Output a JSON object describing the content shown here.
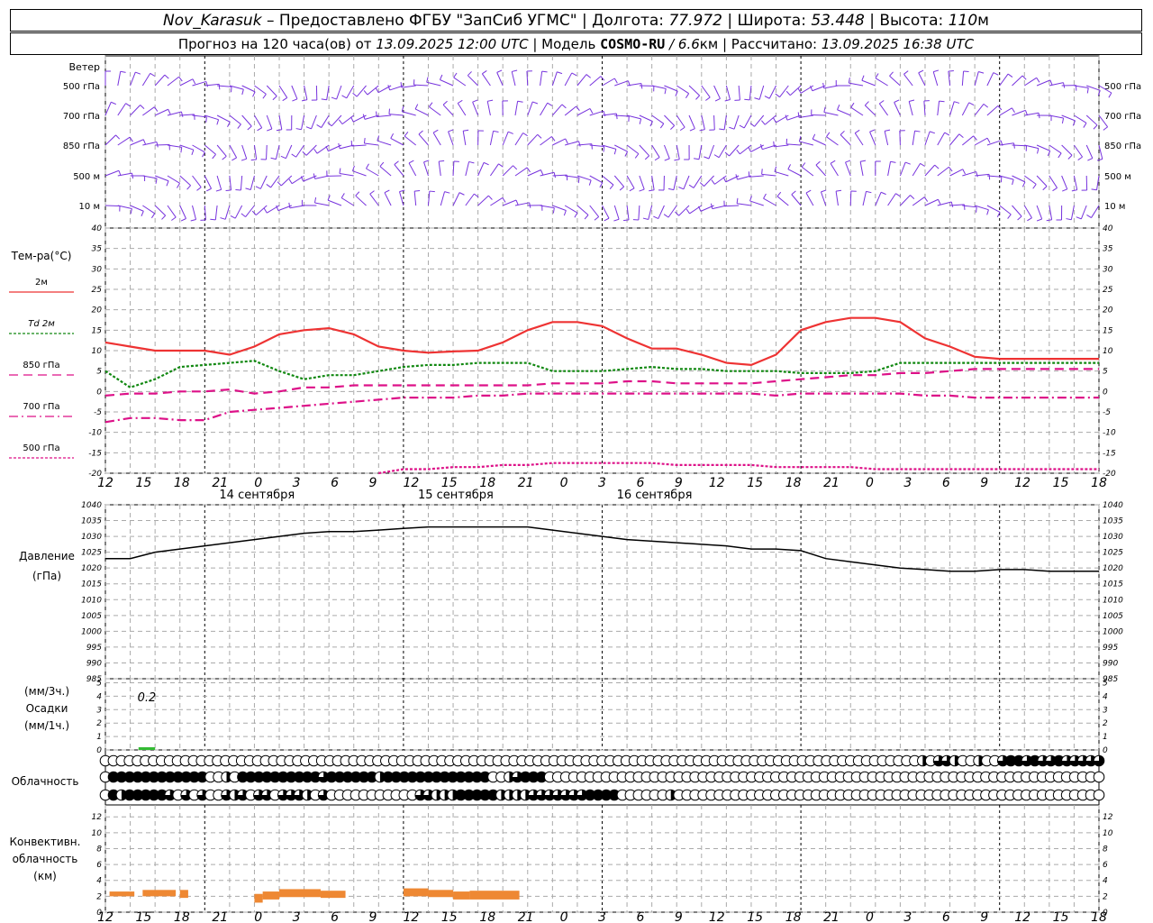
{
  "header": {
    "station": "Nov_Karasuk",
    "dash": " – ",
    "provider": "Предоставлено ФГБУ \"ЗапСиб УГМС\"",
    "sep": " | ",
    "lon_label": "Долгота: ",
    "lon": "77.972",
    "lat_label": "Широта: ",
    "lat": "53.448",
    "alt_label": "Высота: ",
    "alt": "110",
    "alt_unit": "м",
    "forecast_label": "Прогноз на 120 часа(ов) от ",
    "forecast_start": "13.09.2025 12:00 UTC",
    "model_label": " | Модель ",
    "model": "COSMO-RU",
    "model_res": " / 6.6",
    "model_res_unit": "км",
    "calc_label": " | Рассчитано: ",
    "calc_time": "13.09.2025 16:38 UTC"
  },
  "time_axis": {
    "hour_labels": [
      "12",
      "15",
      "18",
      "21",
      "0",
      "3",
      "6",
      "9",
      "12",
      "15",
      "18",
      "21",
      "0",
      "3",
      "6",
      "9",
      "12",
      "15",
      "18",
      "21",
      "0",
      "3",
      "6",
      "9",
      "12",
      "15",
      "18"
    ],
    "day_labels": [
      "14 сентября",
      "15 сентября",
      "16 сентября"
    ]
  },
  "wind": {
    "title": "Ветер",
    "levels": [
      "500 гПа",
      "700 гПа",
      "850 гПа",
      "500 м",
      "10  м"
    ],
    "color": "#7733dd"
  },
  "temperature": {
    "title": "Тем-ра(°C)",
    "legend": [
      {
        "label": "2м",
        "color": "#ee3333",
        "style": "solid"
      },
      {
        "label": "Td  2м",
        "color": "#118811",
        "style": "dotted"
      },
      {
        "label": "850 гПа",
        "color": "#dd1188",
        "style": "dashed"
      },
      {
        "label": "700 гПа",
        "color": "#dd1188",
        "style": "dashdot"
      },
      {
        "label": "500 гПа",
        "color": "#dd1188",
        "style": "dotted"
      }
    ]
  },
  "pressure": {
    "title": "Давление",
    "unit": "(гПа)"
  },
  "precip": {
    "unit3": "(мм/3ч.)",
    "title": "Осадки",
    "unit1": "(мм/1ч.)",
    "annotation": "0.2",
    "color": "#33bb33"
  },
  "clouds": {
    "title": "Облачность"
  },
  "convective": {
    "title_line1": "Конвективн.",
    "title_line2": "облачность",
    "unit": "(км)",
    "color": "#ee8833"
  },
  "chart_data": [
    {
      "type": "line",
      "title": "Тем-ра(°C)",
      "x": [
        0,
        3,
        6,
        9,
        12,
        15,
        18,
        21,
        24,
        27,
        30,
        33,
        36,
        39,
        42,
        45,
        48,
        51,
        54,
        57,
        60,
        63,
        66,
        69,
        72,
        75,
        78,
        81,
        84,
        87,
        90,
        93,
        96,
        99,
        102,
        105,
        108,
        111,
        114,
        117,
        120
      ],
      "x_unit": "hours from 13.09.2025 12:00 UTC",
      "ylim": [
        -20,
        40
      ],
      "yticks": [
        -20,
        -15,
        -10,
        -5,
        0,
        5,
        10,
        15,
        20,
        25,
        30,
        35,
        40
      ],
      "series": [
        {
          "name": "2м",
          "values": [
            12,
            11,
            10,
            10,
            10,
            9,
            11,
            14,
            15,
            15.5,
            14,
            11,
            10,
            9.5,
            9.8,
            10,
            12,
            15,
            17,
            17,
            16,
            13,
            10.5,
            10.5,
            9,
            7,
            6.5,
            9,
            15,
            17,
            18,
            18,
            17,
            13,
            11,
            8.5,
            8,
            8,
            8,
            8,
            8
          ]
        },
        {
          "name": "Td  2м",
          "values": [
            5,
            1,
            3,
            6,
            6.5,
            7,
            7.5,
            5,
            3,
            4,
            4,
            5,
            6,
            6.5,
            6.5,
            7,
            7,
            7,
            5,
            5,
            5,
            5.5,
            6,
            5.5,
            5.5,
            5,
            5,
            5,
            4.5,
            4.5,
            4.5,
            5,
            7,
            7,
            7,
            7,
            7,
            7,
            7,
            7,
            7
          ]
        },
        {
          "name": "850 гПа",
          "values": [
            -1,
            -0.5,
            -0.5,
            0,
            0,
            0.5,
            -0.5,
            0,
            1,
            1,
            1.5,
            1.5,
            1.5,
            1.5,
            1.5,
            1.5,
            1.5,
            1.5,
            2,
            2,
            2,
            2.5,
            2.5,
            2,
            2,
            2,
            2,
            2.5,
            3,
            3.5,
            4,
            4,
            4.5,
            4.5,
            5,
            5.5,
            5.5,
            5.5,
            5.5,
            5.5,
            5.5
          ]
        },
        {
          "name": "700 гПа",
          "values": [
            -7.5,
            -6.5,
            -6.5,
            -7,
            -7,
            -5,
            -4.5,
            -4,
            -3.5,
            -3,
            -2.5,
            -2,
            -1.5,
            -1.5,
            -1.5,
            -1,
            -1,
            -0.5,
            -0.5,
            -0.5,
            -0.5,
            -0.5,
            -0.5,
            -0.5,
            -0.5,
            -0.5,
            -0.5,
            -1,
            -0.5,
            -0.5,
            -0.5,
            -0.5,
            -0.5,
            -1,
            -1,
            -1.5,
            -1.5,
            -1.5,
            -1.5,
            -1.5,
            -1.5
          ]
        },
        {
          "name": "500 гПа",
          "values": [
            null,
            null,
            null,
            null,
            null,
            null,
            null,
            null,
            null,
            null,
            null,
            -20,
            -19,
            -19,
            -18.5,
            -18.5,
            -18,
            -18,
            -17.5,
            -17.5,
            -17.5,
            -17.5,
            -17.5,
            -18,
            -18,
            -18,
            -18,
            -18.5,
            -18.5,
            -18.5,
            -18.5,
            -19,
            -19,
            -19,
            -19,
            -19,
            -19,
            -19,
            -19,
            -19,
            -19
          ]
        }
      ]
    },
    {
      "type": "line",
      "title": "Давление",
      "ylabel": "(гПа)",
      "ylim": [
        985,
        1040
      ],
      "yticks": [
        985,
        990,
        995,
        1000,
        1005,
        1010,
        1015,
        1020,
        1025,
        1030,
        1035,
        1040
      ],
      "x": [
        0,
        3,
        6,
        9,
        12,
        15,
        18,
        21,
        24,
        27,
        30,
        33,
        36,
        39,
        42,
        45,
        48,
        51,
        54,
        57,
        60,
        63,
        66,
        69,
        72,
        75,
        78,
        81,
        84,
        87,
        90,
        93,
        96,
        99,
        102,
        105,
        108,
        111,
        114,
        117,
        120
      ],
      "series": [
        {
          "name": "Давление",
          "values": [
            1023,
            1023,
            1025,
            1026,
            1027,
            1028,
            1029,
            1030,
            1031,
            1031.5,
            1031.5,
            1032,
            1032.5,
            1033,
            1033,
            1033,
            1033,
            1033,
            1032,
            1031,
            1030,
            1029,
            1028.5,
            1028,
            1027.5,
            1027,
            1026,
            1026,
            1025.5,
            1023,
            1022,
            1021,
            1020,
            1019.5,
            1019,
            1019,
            1019.5,
            1019.5,
            1019,
            1019,
            1019
          ]
        }
      ]
    },
    {
      "type": "bar",
      "title": "Осадки",
      "ylabel": "(мм/3ч.) / (мм/1ч.)",
      "ylim": [
        0,
        5
      ],
      "yticks": [
        0,
        1,
        2,
        3,
        4,
        5
      ],
      "bars": [
        {
          "x_from": 4,
          "x_to": 6,
          "value": 0.2
        }
      ]
    },
    {
      "type": "bar",
      "title": "Конвективн. облачность",
      "ylabel": "(км)",
      "ylim": [
        0,
        13
      ],
      "yticks": [
        0,
        2,
        4,
        6,
        8,
        10,
        12
      ],
      "bars": [
        {
          "x_from": 0.5,
          "x_to": 3.5,
          "base": 2,
          "top": 2.6
        },
        {
          "x_from": 4.5,
          "x_to": 8.5,
          "base": 2,
          "top": 2.8
        },
        {
          "x_from": 9,
          "x_to": 10,
          "base": 1.8,
          "top": 2.8
        },
        {
          "x_from": 18,
          "x_to": 19,
          "base": 1.2,
          "top": 2.3
        },
        {
          "x_from": 19,
          "x_to": 21,
          "base": 1.6,
          "top": 2.6
        },
        {
          "x_from": 21,
          "x_to": 26,
          "base": 1.9,
          "top": 2.9
        },
        {
          "x_from": 26,
          "x_to": 29,
          "base": 1.8,
          "top": 2.7
        },
        {
          "x_from": 36,
          "x_to": 39,
          "base": 2.0,
          "top": 3.0
        },
        {
          "x_from": 39,
          "x_to": 42,
          "base": 1.9,
          "top": 2.8
        },
        {
          "x_from": 42,
          "x_to": 44,
          "base": 1.6,
          "top": 2.6
        },
        {
          "x_from": 44,
          "x_to": 50,
          "base": 1.6,
          "top": 2.7
        }
      ]
    },
    {
      "type": "table",
      "title": "Облачность",
      "rows_note": "three cloud layers (top to bottom), 0=clear ... 4=overcast",
      "rows": [
        [
          0,
          0,
          0,
          0,
          0,
          0,
          0,
          0,
          0,
          0,
          0,
          0,
          0,
          0,
          0,
          0,
          0,
          0,
          0,
          0,
          0,
          0,
          0,
          0,
          0,
          0,
          0,
          0,
          0,
          0,
          0,
          0,
          0,
          0,
          0,
          0,
          0,
          0,
          0,
          0,
          0,
          0,
          0,
          0,
          0,
          0,
          0,
          0,
          0,
          0,
          0,
          0,
          0,
          0,
          0,
          0,
          0,
          0,
          0,
          0,
          0,
          0,
          0,
          0,
          0,
          0,
          0,
          0,
          0,
          0,
          0,
          0,
          0,
          0,
          0,
          0,
          0,
          0,
          0,
          0,
          0,
          0,
          0,
          0,
          0,
          0,
          0,
          0,
          0,
          0,
          0,
          0,
          0,
          0,
          0,
          0,
          0,
          0,
          0,
          0,
          0,
          0,
          2,
          0,
          3,
          3,
          2,
          0,
          0,
          2,
          0,
          0,
          3,
          4,
          4,
          3,
          4,
          3,
          3,
          4,
          3,
          3,
          3,
          3,
          3
        ],
        [
          0,
          4,
          4,
          4,
          4,
          4,
          4,
          4,
          4,
          4,
          4,
          4,
          4,
          0,
          0,
          2,
          0,
          4,
          4,
          4,
          4,
          4,
          4,
          4,
          4,
          4,
          4,
          3,
          4,
          4,
          4,
          4,
          4,
          4,
          2,
          4,
          4,
          4,
          4,
          4,
          4,
          4,
          4,
          4,
          4,
          4,
          4,
          4,
          0,
          0,
          2,
          3,
          4,
          4,
          4,
          0,
          0,
          0,
          0,
          0,
          0,
          0,
          0,
          0,
          0,
          0,
          0,
          0,
          0,
          0,
          0,
          0,
          0,
          0,
          0,
          0,
          0,
          0,
          0,
          0,
          0,
          0,
          0,
          0,
          0,
          0,
          0,
          0,
          0,
          0,
          0,
          0,
          0,
          0,
          0,
          0,
          0,
          0,
          0,
          0,
          0,
          0,
          0,
          0,
          0,
          0,
          0,
          0,
          0,
          0,
          0,
          0,
          0,
          0,
          0,
          0,
          0,
          0,
          0,
          0,
          0,
          0,
          0,
          0
        ],
        [
          0,
          4,
          2,
          4,
          4,
          4,
          4,
          4,
          3,
          0,
          3,
          0,
          3,
          0,
          0,
          3,
          2,
          3,
          0,
          3,
          3,
          0,
          3,
          3,
          3,
          2,
          0,
          3,
          0,
          0,
          0,
          0,
          0,
          0,
          0,
          0,
          0,
          0,
          0,
          3,
          3,
          2,
          2,
          2,
          4,
          4,
          4,
          4,
          4,
          2,
          2,
          2,
          2,
          3,
          3,
          3,
          3,
          3,
          3,
          3,
          4,
          4,
          4,
          4,
          0,
          0,
          0,
          0,
          0,
          0,
          2,
          0,
          0,
          0,
          0,
          0,
          0,
          0,
          0,
          0,
          0,
          0,
          0,
          0,
          0,
          0,
          0,
          0,
          0,
          0,
          0,
          0,
          0,
          0,
          0,
          0,
          0,
          0,
          0,
          0,
          0,
          0,
          0,
          0,
          0,
          0,
          0,
          0,
          0,
          0,
          0,
          0,
          0,
          0,
          0,
          0,
          0,
          0,
          0,
          0,
          0,
          0,
          0,
          0
        ]
      ]
    }
  ]
}
